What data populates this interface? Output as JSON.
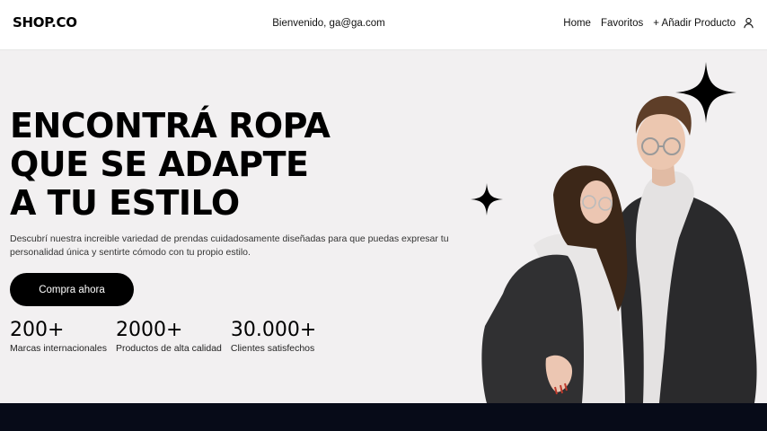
{
  "header": {
    "logo": "SHOP.CO",
    "welcome": "Bienvenido, ga@ga.com",
    "nav": {
      "home": "Home",
      "favorites": "Favoritos",
      "add_product": "+ Añadir Producto"
    },
    "user_icon": "user-icon"
  },
  "hero": {
    "headline": [
      "ENCONTRÁ ROPA",
      "QUE SE ADAPTE",
      "A TU ESTILO"
    ],
    "subtitle": "Descubrí nuestra increible variedad de prendas cuidadosamente diseñadas para que puedas expresar tu personalidad única y sentirte cómodo con tu propio estilo.",
    "cta": "Compra ahora",
    "stats": [
      {
        "value": "200+",
        "label": "Marcas internacionales"
      },
      {
        "value": "2000+",
        "label": "Productos de alta calidad"
      },
      {
        "value": "30.000+",
        "label": "Clientes satisfechos"
      }
    ],
    "decor_icons": [
      "sparkle-star-icon",
      "sparkle-star-icon"
    ]
  },
  "colors": {
    "hero_bg": "#f2f0f1",
    "primary": "#000000",
    "footer_bg": "#070b18"
  }
}
